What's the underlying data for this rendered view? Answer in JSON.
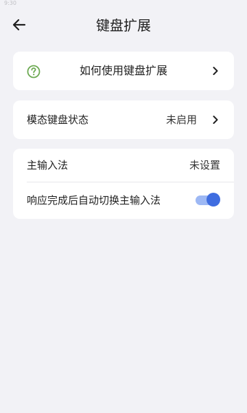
{
  "status_bar": {
    "time": "9:30"
  },
  "header": {
    "title": "键盘扩展",
    "back_icon": "arrow-left-icon"
  },
  "help_card": {
    "label": "如何使用键盘扩展",
    "icon": "question-circle-icon",
    "icon_color": "#6aa84f"
  },
  "mode_card": {
    "label": "模态键盘状态",
    "value": "未启用"
  },
  "ime_card": {
    "primary_ime_label": "主输入法",
    "primary_ime_value": "未设置",
    "auto_switch_label": "响应完成后自动切换主输入法",
    "auto_switch_enabled": true,
    "toggle_color": "#3f6de0"
  }
}
